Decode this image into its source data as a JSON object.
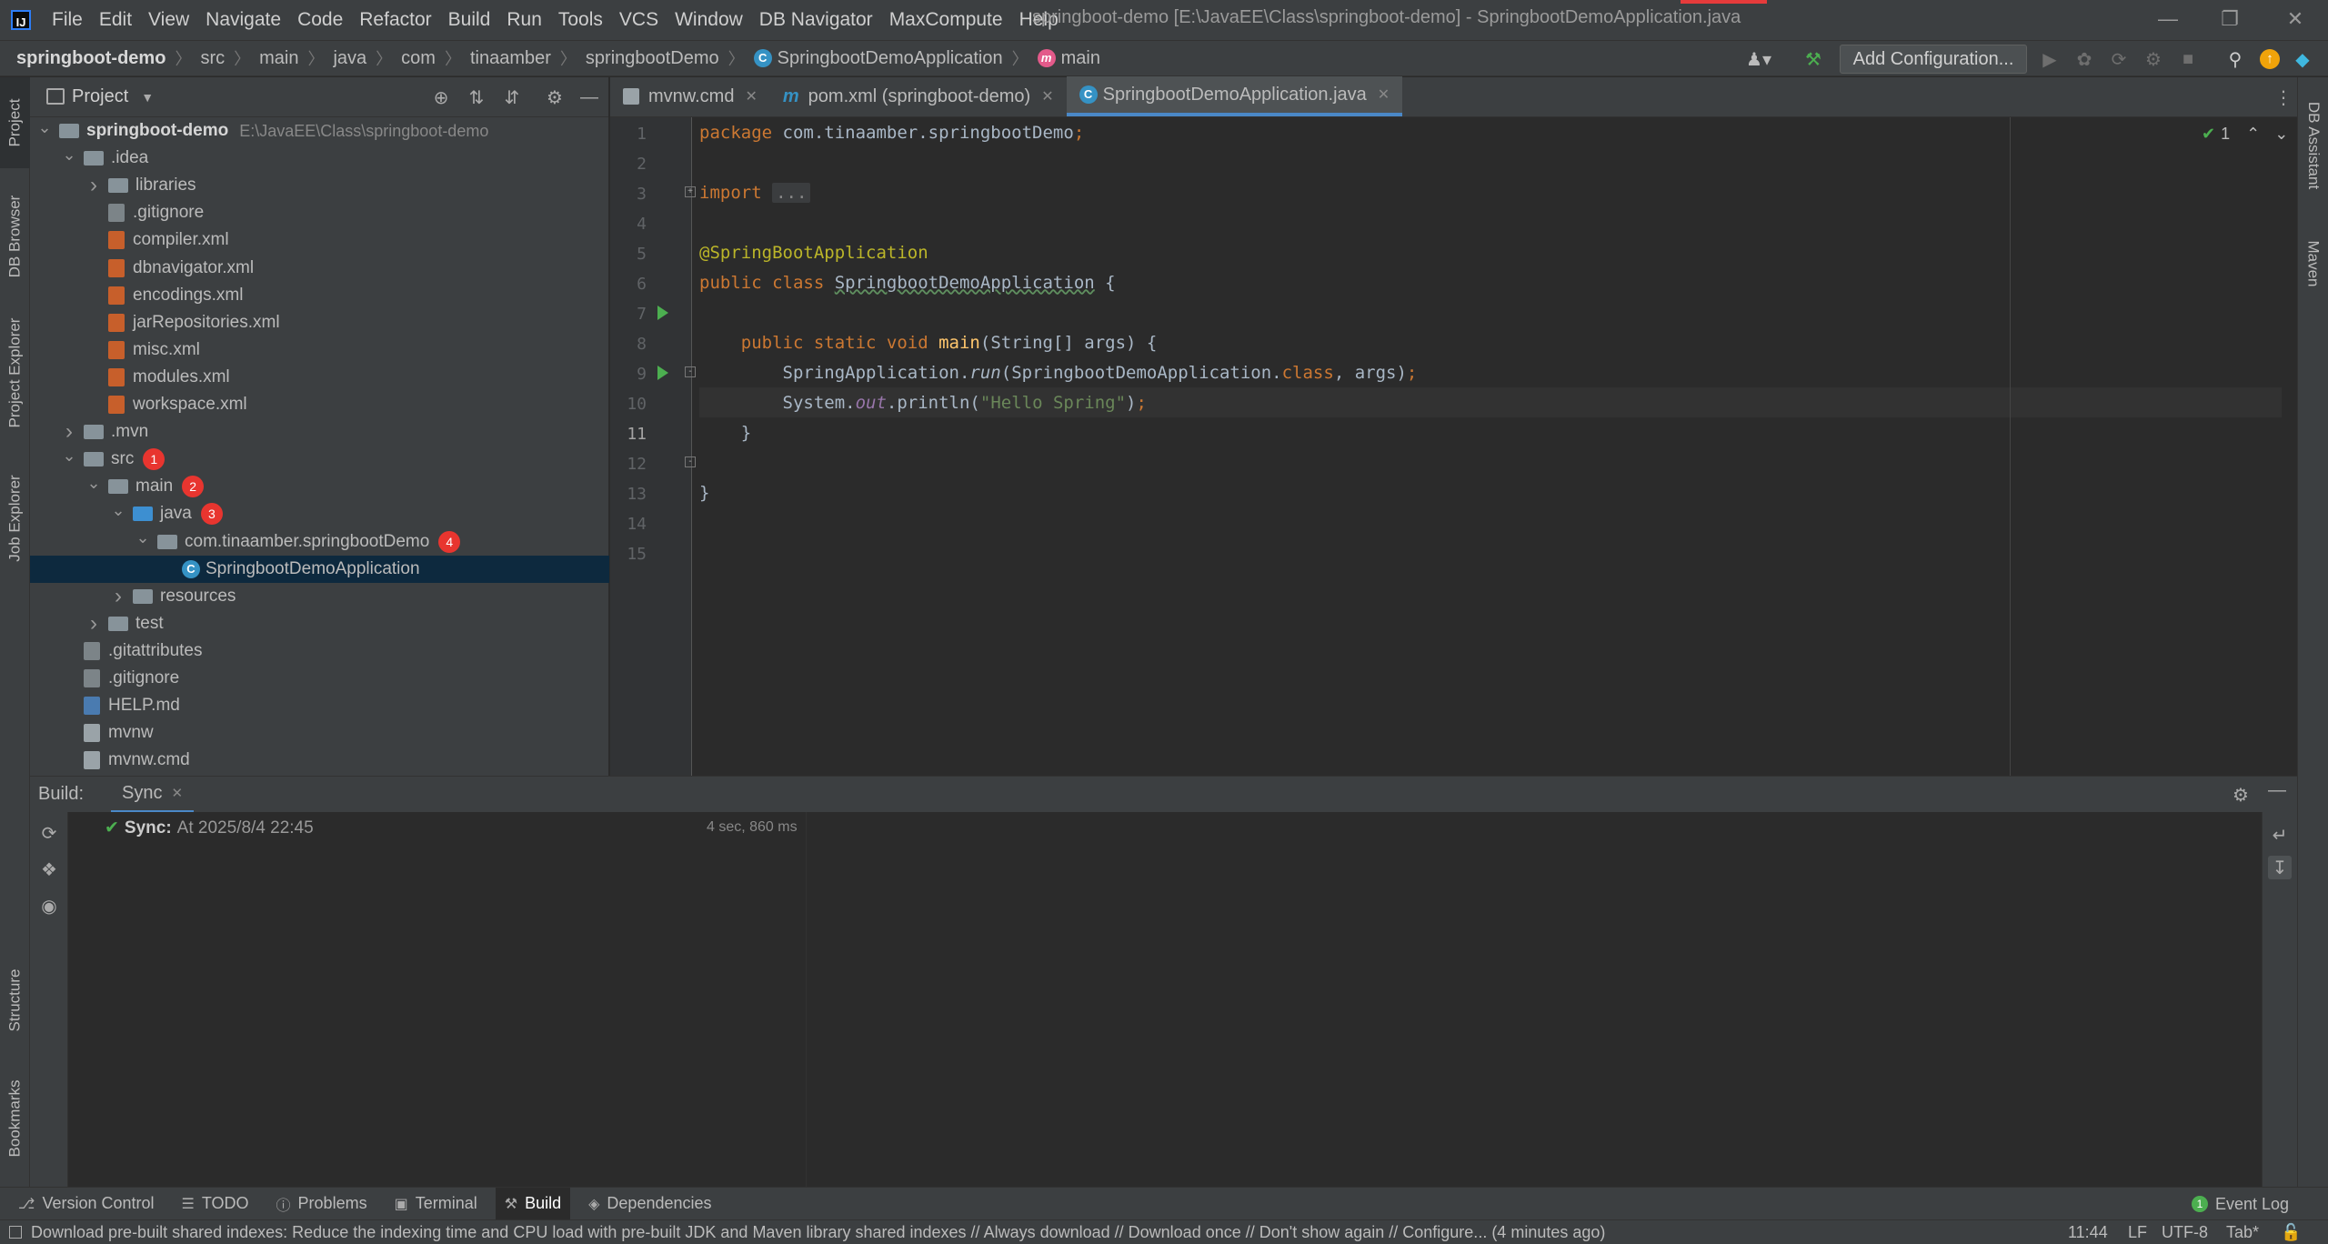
{
  "app": {
    "window_title": "springboot-demo [E:\\JavaEE\\Class\\springboot-demo] - SpringbootDemoApplication.java",
    "menu": [
      "File",
      "Edit",
      "View",
      "Navigate",
      "Code",
      "Refactor",
      "Build",
      "Run",
      "Tools",
      "VCS",
      "Window",
      "DB Navigator",
      "MaxCompute",
      "Help"
    ]
  },
  "breadcrumb": [
    "springboot-demo",
    "src",
    "main",
    "java",
    "com",
    "tinaamber",
    "springbootDemo",
    "SpringbootDemoApplication",
    "main"
  ],
  "toolbar": {
    "add_configuration": "Add Configuration..."
  },
  "left_stripe": [
    "Project",
    "DB Browser",
    "Project Explorer",
    "Job Explorer",
    "Structure",
    "Bookmarks"
  ],
  "right_stripe": [
    "DB Assistant",
    "Maven"
  ],
  "project": {
    "title": "Project",
    "tree": [
      {
        "label": "springboot-demo",
        "path": "E:\\JavaEE\\Class\\springboot-demo",
        "depth": 0,
        "arrow": "down",
        "icon": "folder",
        "bold": true
      },
      {
        "label": ".idea",
        "depth": 1,
        "arrow": "down",
        "icon": "folder"
      },
      {
        "label": "libraries",
        "depth": 2,
        "arrow": "right",
        "icon": "folder"
      },
      {
        "label": ".gitignore",
        "depth": 2,
        "icon": "git"
      },
      {
        "label": "compiler.xml",
        "depth": 2,
        "icon": "xml"
      },
      {
        "label": "dbnavigator.xml",
        "depth": 2,
        "icon": "xml"
      },
      {
        "label": "encodings.xml",
        "depth": 2,
        "icon": "xml"
      },
      {
        "label": "jarRepositories.xml",
        "depth": 2,
        "icon": "xml"
      },
      {
        "label": "misc.xml",
        "depth": 2,
        "icon": "xml"
      },
      {
        "label": "modules.xml",
        "depth": 2,
        "icon": "xml"
      },
      {
        "label": "workspace.xml",
        "depth": 2,
        "icon": "xml"
      },
      {
        "label": ".mvn",
        "depth": 1,
        "arrow": "right",
        "icon": "folder"
      },
      {
        "label": "src",
        "depth": 1,
        "arrow": "down",
        "icon": "folder",
        "badge": "1"
      },
      {
        "label": "main",
        "depth": 2,
        "arrow": "down",
        "icon": "folder",
        "badge": "2"
      },
      {
        "label": "java",
        "depth": 3,
        "arrow": "down",
        "icon": "folder-blue",
        "badge": "3"
      },
      {
        "label": "com.tinaamber.springbootDemo",
        "depth": 4,
        "arrow": "down",
        "icon": "package",
        "badge": "4"
      },
      {
        "label": "SpringbootDemoApplication",
        "depth": 5,
        "icon": "spring-class",
        "selected": true
      },
      {
        "label": "resources",
        "depth": 3,
        "arrow": "right",
        "icon": "folder"
      },
      {
        "label": "test",
        "depth": 2,
        "arrow": "right",
        "icon": "folder"
      },
      {
        "label": ".gitattributes",
        "depth": 1,
        "icon": "git"
      },
      {
        "label": ".gitignore",
        "depth": 1,
        "icon": "git"
      },
      {
        "label": "HELP.md",
        "depth": 1,
        "icon": "md"
      },
      {
        "label": "mvnw",
        "depth": 1,
        "icon": "txt"
      },
      {
        "label": "mvnw.cmd",
        "depth": 1,
        "icon": "txt"
      }
    ]
  },
  "editor": {
    "tabs": [
      {
        "label": "mvnw.cmd",
        "active": false,
        "icon": "txt"
      },
      {
        "label": "pom.xml (springboot-demo)",
        "active": false,
        "icon": "maven"
      },
      {
        "label": "SpringbootDemoApplication.java",
        "active": true,
        "icon": "spring-class"
      }
    ],
    "inspection_count": "1",
    "current_line": 11,
    "lines": [
      "1",
      "2",
      "3",
      "4",
      "5",
      "6",
      "7",
      "8",
      "9",
      "10",
      "11",
      "12",
      "13",
      "14",
      "15"
    ],
    "code": {
      "l1_kw": "package ",
      "l1_pkg": "com.tinaamber.springbootDemo",
      "l1_semi": ";",
      "l3_kw": "import ",
      "l3_fold": "...",
      "l6_ann": "@SpringBootApplication",
      "l7_kw": "public class ",
      "l7_cls": "SpringbootDemoApplication",
      "l7_rest": " {",
      "l9_kw": "public static void ",
      "l9_fn": "main",
      "l9_rest": "(String[] args) {",
      "l10_a": "SpringApplication.",
      "l10_run": "run",
      "l10_b": "(SpringbootDemoApplication.",
      "l10_class": "class",
      "l10_c": ", args)",
      "l10_semi": ";",
      "l11_a": "System.",
      "l11_out": "out",
      "l11_b": ".println(",
      "l11_str": "\"Hello Spring\"",
      "l11_c": ")",
      "l11_semi": ";",
      "l12": "}",
      "l14": "}"
    }
  },
  "build": {
    "label": "Build:",
    "tab": "Sync",
    "sync_label": "Sync:",
    "sync_time": "At 2025/8/4 22:45",
    "duration": "4 sec, 860 ms"
  },
  "bottom_tools": [
    {
      "label": "Version Control",
      "icon": "branch-icon"
    },
    {
      "label": "TODO",
      "icon": "list-icon"
    },
    {
      "label": "Problems",
      "icon": "info-icon"
    },
    {
      "label": "Terminal",
      "icon": "terminal-icon"
    },
    {
      "label": "Build",
      "icon": "hammer-icon",
      "active": true
    },
    {
      "label": "Dependencies",
      "icon": "layers-icon"
    }
  ],
  "event_log": {
    "label": "Event Log",
    "count": "1"
  },
  "status": {
    "message": "Download pre-built shared indexes: Reduce the indexing time and CPU load with pre-built JDK and Maven library shared indexes // Always download // Download once // Don't show again // Configure... (4 minutes ago)",
    "position": "11:44",
    "line_sep": "LF",
    "encoding": "UTF-8",
    "indent": "Tab*"
  },
  "colors": {
    "accent": "#4a88c7",
    "badge": "#e8352f",
    "selection": "#0d293e"
  }
}
